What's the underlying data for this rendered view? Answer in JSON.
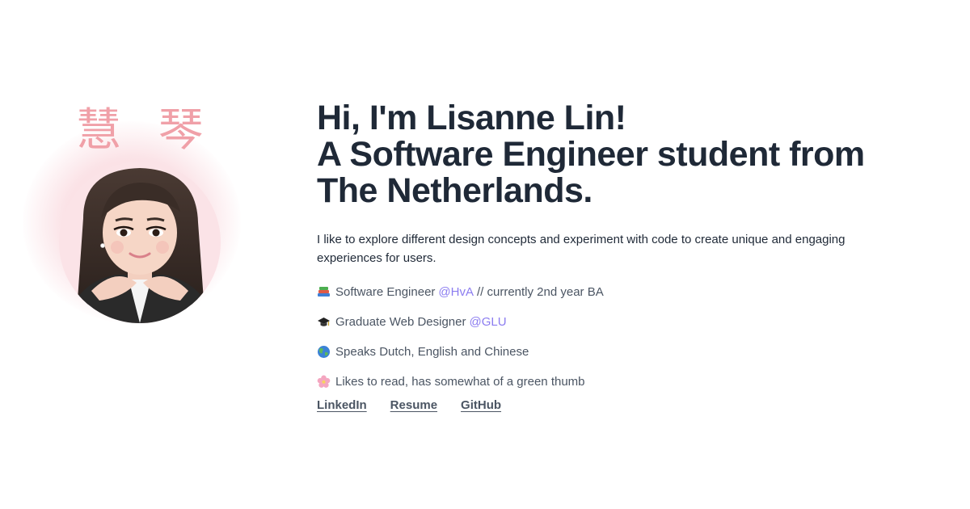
{
  "profile": {
    "chinese_name": "慧 琴"
  },
  "hero": {
    "line1": "Hi, I'm Lisanne Lin!",
    "line2": "A Software Engineer student from",
    "line3": "The Netherlands.",
    "intro": "I like to explore different design concepts and experiment with code to create unique and engaging experiences for users."
  },
  "facts": [
    {
      "icon": "books-icon",
      "text_before": "Software Engineer",
      "mention": "@HvA",
      "text_after": "// currently 2nd year BA"
    },
    {
      "icon": "graduation-cap-icon",
      "text_before": "Graduate Web Designer",
      "mention": "@GLU",
      "text_after": ""
    },
    {
      "icon": "globe-icon",
      "text_before": "Speaks Dutch, English and Chinese",
      "mention": "",
      "text_after": ""
    },
    {
      "icon": "blossom-icon",
      "text_before": "Likes to read, has somewhat of a green thumb",
      "mention": "",
      "text_after": ""
    }
  ],
  "links": {
    "linkedin": "LinkedIn",
    "resume": "Resume",
    "github": "GitHub"
  },
  "colors": {
    "heading": "#1f2937",
    "body": "#4b5563",
    "accent": "#8b7cf0",
    "name_pink": "#f0a0a8",
    "glow_pink": "#f9d4da"
  }
}
